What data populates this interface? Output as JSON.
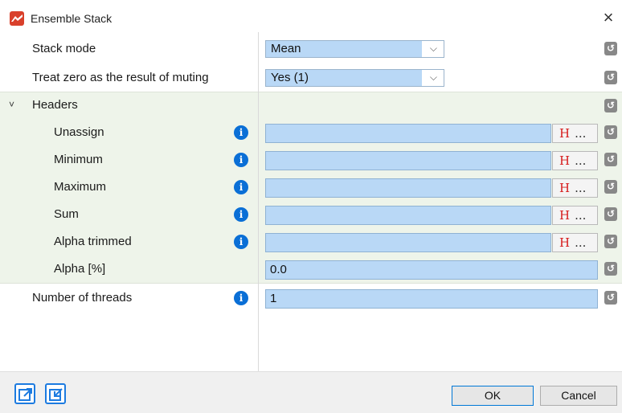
{
  "window": {
    "title": "Ensemble Stack",
    "close_glyph": "×",
    "app_icon": "app-logo-icon"
  },
  "rows": {
    "stack_mode": {
      "label": "Stack mode",
      "value": "Mean"
    },
    "treat_zero": {
      "label": "Treat zero as the result of muting",
      "value": "Yes (1)"
    },
    "headers": {
      "label": "Headers",
      "expander": "˅"
    },
    "unassign": {
      "label": "Unassign",
      "value": ""
    },
    "minimum": {
      "label": "Minimum",
      "value": ""
    },
    "maximum": {
      "label": "Maximum",
      "value": ""
    },
    "sum": {
      "label": "Sum",
      "value": ""
    },
    "alpha_trimmed": {
      "label": "Alpha trimmed",
      "value": ""
    },
    "alpha_pct": {
      "label": "Alpha [%]",
      "value": "0.0"
    },
    "threads": {
      "label": "Number of threads",
      "value": "1"
    }
  },
  "header_button": {
    "h": "H",
    "dots": "..."
  },
  "info_glyph": "i",
  "reset_glyph": "↺",
  "chevron_glyph": "⌵",
  "footer": {
    "ok_label": "OK",
    "cancel_label": "Cancel",
    "icons": [
      "export-icon",
      "import-icon"
    ]
  },
  "colors": {
    "field_fill": "#b9d8f6",
    "section_shade": "#eef4ea",
    "info_blue": "#0a6fd6",
    "h_red": "#d61b1b",
    "app_icon": "#d9402b"
  }
}
